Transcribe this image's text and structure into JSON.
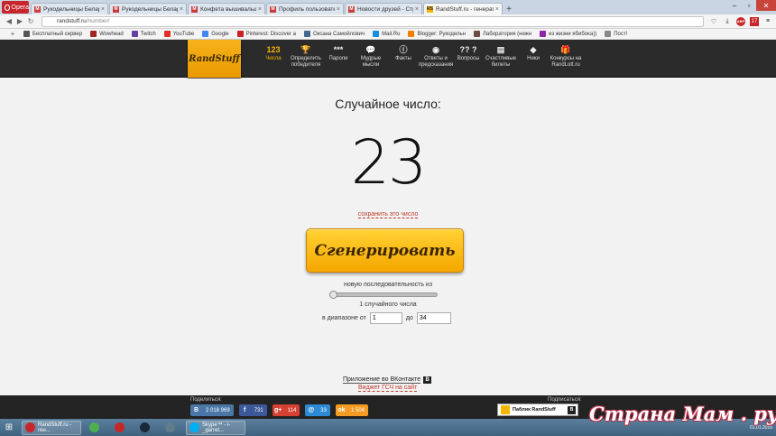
{
  "browser": {
    "menu_label": "Opera",
    "tabs": [
      {
        "label": "Рукодельницы Беларуси",
        "favicon": "M"
      },
      {
        "label": "Рукодельницы Беларуси",
        "favicon": "M"
      },
      {
        "label": "Конфета вышивальщицы",
        "favicon": "M"
      },
      {
        "label": "Профиль пользователя",
        "favicon": "M"
      },
      {
        "label": "Новости друзей - Стран",
        "favicon": "M"
      },
      {
        "label": "RandStuff.ru - генератор",
        "favicon": "RS",
        "active": true
      }
    ],
    "new_tab": "+",
    "url_host": "randstuff.ru",
    "url_path": "/number/",
    "bookmarks": [
      {
        "label": "Бесплатный сервер",
        "color": "#555555"
      },
      {
        "label": "Wowhead",
        "color": "#a1261f"
      },
      {
        "label": "Twitch",
        "color": "#6441a5"
      },
      {
        "label": "YouTube",
        "color": "#e52d27"
      },
      {
        "label": "Google",
        "color": "#4285f4"
      },
      {
        "label": "Pinterest: Discover a",
        "color": "#cb2027"
      },
      {
        "label": "Оксана Самойлович",
        "color": "#45668e"
      },
      {
        "label": "Mail.Ru",
        "color": "#168de2"
      },
      {
        "label": "Blogger: Рукодельн",
        "color": "#f57d00"
      },
      {
        "label": "Лаборатория (нежн",
        "color": "#6d4c41"
      },
      {
        "label": "из жизни ябибока))",
        "color": "#8e24aa"
      },
      {
        "label": "Пост!",
        "color": "#888888"
      }
    ]
  },
  "site": {
    "logo": "RandStuff",
    "nav": [
      {
        "icon": "123",
        "label": "Числа",
        "active": true
      },
      {
        "icon": "🏆",
        "label": "Определить\nпобедителя"
      },
      {
        "icon": "***",
        "label": "Пароли"
      },
      {
        "icon": "💬",
        "label": "Мудрые\nмысли"
      },
      {
        "icon": "ⓘ",
        "label": "Факты"
      },
      {
        "icon": "◉",
        "label": "Ответы и\nпредсказания"
      },
      {
        "icon": "?? ?",
        "label": "Вопросы"
      },
      {
        "icon": "▤",
        "label": "Счастливые\nбилеты"
      },
      {
        "icon": "◆",
        "label": "Ники"
      },
      {
        "icon": "🎁",
        "label": "Конкурсы на\nRandLott.ru"
      }
    ]
  },
  "main": {
    "title": "Случайное число:",
    "number": "23",
    "save_link": "сохранить это число",
    "generate_button": "Сгенерировать",
    "sequence_label": "новую последовательность из",
    "slider_fraction": 0.0,
    "count_label": "1 случайного числа",
    "range_from_label": "в диапазоне от",
    "range_from": "1",
    "range_to_label": "до",
    "range_to": "34",
    "vk_app_label": "Приложение во ВКонтакте",
    "widget_link": "Виджет ГСЧ на сайт"
  },
  "footer": {
    "share_label": "Поделиться:",
    "shares": [
      {
        "icon": "В",
        "count": "2 018 969",
        "color": "#4a76a8"
      },
      {
        "icon": "f",
        "count": "731",
        "color": "#3b5998"
      },
      {
        "icon": "g+",
        "count": "114",
        "color": "#d44132"
      },
      {
        "icon": "@",
        "count": "33",
        "color": "#2c8ad4"
      },
      {
        "icon": "ok",
        "count": "1 504",
        "color": "#f59a22"
      }
    ],
    "subscribe_label": "Подписаться:",
    "vk_public": "Паблик RandStuff"
  },
  "taskbar": {
    "items": [
      {
        "label": "RandStuff.ru - ген...",
        "color": "#c8262a"
      },
      {
        "label": "",
        "color": "#4caf50"
      },
      {
        "label": "",
        "color": "#c62828"
      },
      {
        "label": "",
        "color": "#1b2838"
      },
      {
        "label": "",
        "color": "#607d8b"
      },
      {
        "label": "Skype™ - i-_garret...",
        "color": "#00aff0"
      }
    ],
    "date": "01.01.2016"
  },
  "watermark": "Страна Мам . ру"
}
